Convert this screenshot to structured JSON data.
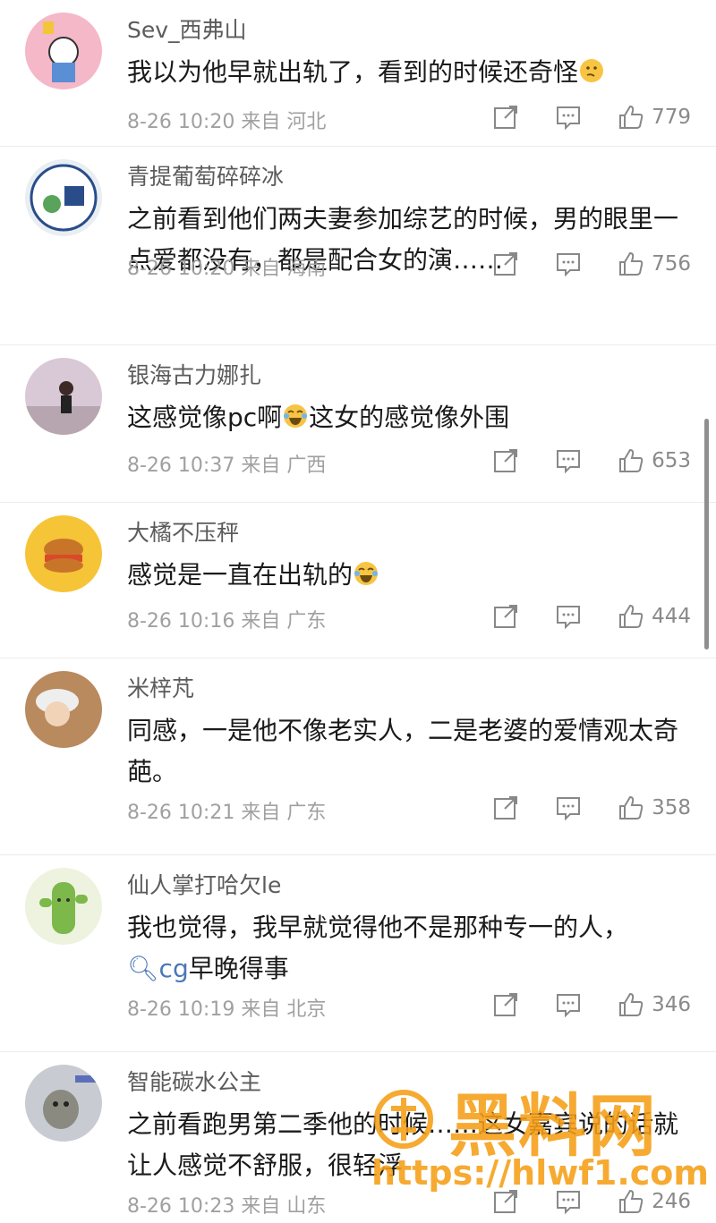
{
  "comments": [
    {
      "user": "Sev_西弗山",
      "text": "我以为他早就出轨了，看到的时候还奇怪",
      "emoji": "thinking-face",
      "time": "8-26 10:20",
      "from": "来自",
      "location": "河北",
      "likes": "779"
    },
    {
      "user": "青提葡萄碎碎冰",
      "text": "之前看到他们两夫妻参加综艺的时候，男的眼里一点爱都没有，都是配合女的演……",
      "time": "8-26 10:20",
      "from": "来自",
      "location": "海南",
      "likes": "756"
    },
    {
      "user": "银海古力娜扎",
      "text_before": "这感觉像pc啊",
      "emoji": "laughing-crying-face",
      "text_after": "这女的感觉像外围",
      "time": "8-26 10:37",
      "from": "来自",
      "location": "广西",
      "likes": "653"
    },
    {
      "user": "大橘不压秤",
      "text": "感觉是一直在出轨的",
      "emoji": "laughing-crying-face",
      "time": "8-26 10:16",
      "from": "来自",
      "location": "广东",
      "likes": "444"
    },
    {
      "user": "米梓芃",
      "text": "同感，一是他不像老实人，二是老婆的爱情观太奇葩。",
      "time": "8-26 10:21",
      "from": "来自",
      "location": "广东",
      "likes": "358"
    },
    {
      "user": "仙人掌打哈欠le",
      "text": "我也觉得，我早就觉得他不是那种专一的人，",
      "tag": "cg",
      "text_after": "早晚得事",
      "time": "8-26 10:19",
      "from": "来自",
      "location": "北京",
      "likes": "346"
    },
    {
      "user": "智能碳水公主",
      "text": "之前看跑男第二季他的时候……这女嘉宾说的话就让人感觉不舒服，很轻浮",
      "time": "8-26 10:23",
      "from": "来自",
      "location": "山东",
      "likes": "246"
    }
  ],
  "watermark": {
    "title": "黑料网",
    "url": "https://hlwf1.com"
  },
  "colors": {
    "text": "#1a1a1a",
    "meta": "#a0a0a0",
    "link": "#4a78b8",
    "watermark": "#f59e14"
  }
}
